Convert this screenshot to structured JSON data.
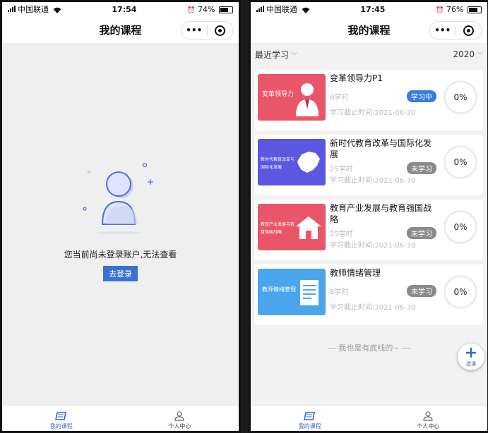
{
  "left": {
    "status": {
      "carrier": "中国联通",
      "time": "17:54",
      "battery": "74%"
    },
    "title": "我的课程",
    "capsule": {
      "more": "•••"
    },
    "empty_text": "您当前尚未登录账户,无法查看",
    "login_button": "去登录",
    "tabs": [
      {
        "label": "我的课程"
      },
      {
        "label": "个人中心"
      }
    ]
  },
  "right": {
    "status": {
      "carrier": "中国联通",
      "time": "17:45",
      "battery": "76%"
    },
    "title": "我的课程",
    "capsule": {
      "more": "•••"
    },
    "filter_left": "最近学习",
    "filter_right": "2020",
    "courses": [
      {
        "title": "变革领导力P1",
        "cover_text": "变革领导力",
        "hours": "8学时",
        "status": "学习中",
        "deadline": "学习截止时间:2021-06-30",
        "progress": "0%",
        "progress_value": 0,
        "cover_color": "#e9566a"
      },
      {
        "title": "新时代教育改革与国际化发展",
        "cover_text": "新时代教育改革与国际化发展",
        "hours": "25学时",
        "status": "未学习",
        "deadline": "学习截止时间:2021-06-30",
        "progress": "0%",
        "progress_value": 0,
        "cover_color": "#5b57e0"
      },
      {
        "title": "教育产业发展与教育强国战略",
        "cover_text": "教育产业发展与教育强国战略",
        "hours": "25学时",
        "status": "未学习",
        "deadline": "学习截止时间:2021-06-30",
        "progress": "0%",
        "progress_value": 0,
        "cover_color": "#e9566a"
      },
      {
        "title": "教师情绪管理",
        "cover_text": "教师情绪管理",
        "hours": "8学时",
        "status": "未学习",
        "deadline": "学习截止时间:2021-06-30",
        "progress": "0%",
        "progress_value": 0,
        "cover_color": "#4aa6ec"
      }
    ],
    "bottom_line": "--- 我也是有底线的~ ---",
    "fab_label": "选课",
    "tabs": [
      {
        "label": "我的课程"
      },
      {
        "label": "个人中心"
      }
    ]
  },
  "colors": {
    "accent": "#3a70d0",
    "badge_studying": "#3a7be0",
    "badge_not": "#8a8a8a"
  },
  "icons": {
    "tab_courses": "book-icon",
    "tab_profile": "person-icon",
    "capsule_more": "more-icon",
    "capsule_close": "target-icon",
    "fab": "plus-icon"
  }
}
